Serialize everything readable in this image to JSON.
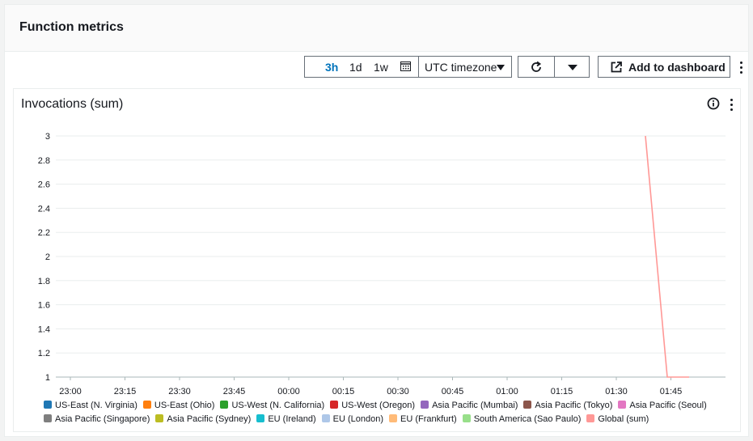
{
  "header": {
    "title": "Function metrics"
  },
  "toolbar": {
    "ranges": [
      "3h",
      "1d",
      "1w"
    ],
    "selected_range": "3h",
    "timezone": "UTC timezone",
    "add_label": "Add to dashboard"
  },
  "widget": {
    "title": "Invocations (sum)"
  },
  "chart_data": {
    "type": "line",
    "title": "Invocations (sum)",
    "xlabel": "",
    "ylabel": "",
    "x_ticks": [
      "23:00",
      "23:15",
      "23:30",
      "23:45",
      "00:00",
      "00:15",
      "00:30",
      "00:45",
      "01:00",
      "01:15",
      "01:30",
      "01:45"
    ],
    "y_ticks": [
      "3",
      "2.8",
      "2.6",
      "2.4",
      "2.2",
      "2",
      "1.8",
      "1.6",
      "1.4",
      "1.2",
      "1"
    ],
    "ylim": [
      1,
      3
    ],
    "x_range": [
      "22:56",
      "02:00"
    ],
    "grid": true,
    "legend_position": "bottom",
    "series": [
      {
        "name": "US-East (N. Virginia)",
        "color": "#1f77b4",
        "points": []
      },
      {
        "name": "US-East (Ohio)",
        "color": "#ff7f0e",
        "points": []
      },
      {
        "name": "US-West (N. California)",
        "color": "#2ca02c",
        "points": []
      },
      {
        "name": "US-West (Oregon)",
        "color": "#d62728",
        "points": []
      },
      {
        "name": "Asia Pacific (Mumbai)",
        "color": "#9467bd",
        "points": []
      },
      {
        "name": "Asia Pacific (Tokyo)",
        "color": "#8c564b",
        "points": []
      },
      {
        "name": "Asia Pacific (Seoul)",
        "color": "#e377c2",
        "points": []
      },
      {
        "name": "Asia Pacific (Singapore)",
        "color": "#7f7f7f",
        "points": []
      },
      {
        "name": "Asia Pacific (Sydney)",
        "color": "#bcbd22",
        "points": []
      },
      {
        "name": "EU (Ireland)",
        "color": "#17becf",
        "points": []
      },
      {
        "name": "EU (London)",
        "color": "#aec7e8",
        "points": []
      },
      {
        "name": "EU (Frankfurt)",
        "color": "#ffbb78",
        "points": []
      },
      {
        "name": "South America (Sao Paulo)",
        "color": "#98df8a",
        "points": []
      },
      {
        "name": "Global (sum)",
        "color": "#ff9896",
        "points": [
          [
            "01:38",
            3
          ],
          [
            "01:44",
            1
          ],
          [
            "01:50",
            1
          ]
        ]
      }
    ]
  }
}
